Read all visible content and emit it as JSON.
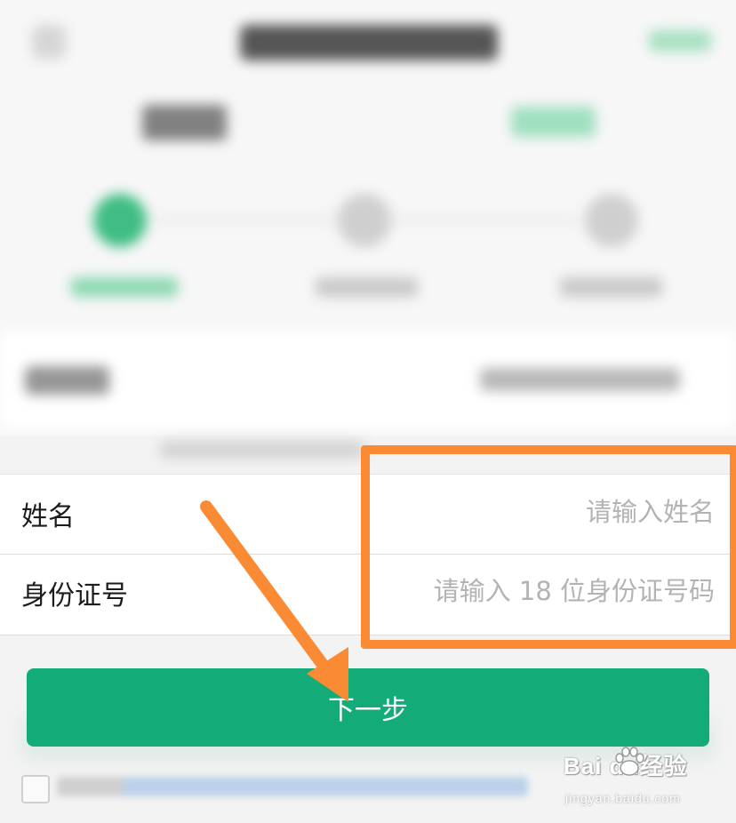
{
  "form": {
    "name_label": "姓名",
    "name_placeholder": "请输入姓名",
    "id_label": "身份证号",
    "id_placeholder": "请输入 18 位身份证号码"
  },
  "next_button_label": "下一步",
  "colors": {
    "primary_green": "#13ac78",
    "annotation_orange": "#fb8a35",
    "placeholder_gray": "#b3b3b3"
  },
  "watermark": {
    "logo_text": "Bai du经验",
    "url": "jingyan.baidu.com"
  }
}
